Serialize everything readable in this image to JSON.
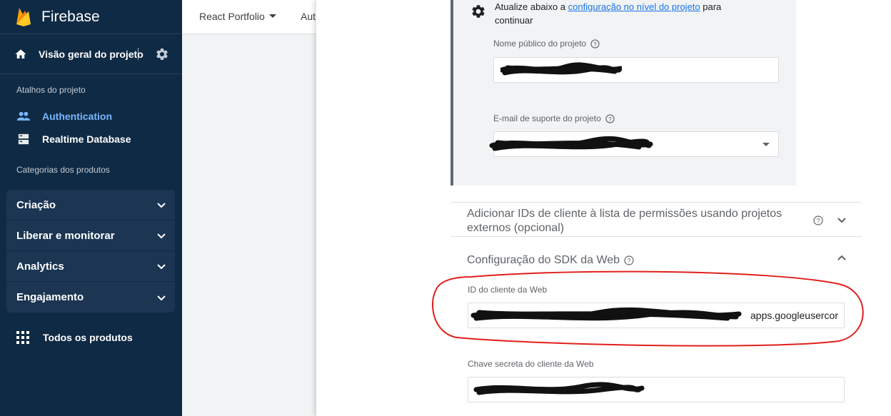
{
  "app": {
    "brand": "Firebase",
    "overview_label": "Visão geral do projeto"
  },
  "sidebar": {
    "shortcuts_title": "Atalhos do projeto",
    "shortcuts": [
      {
        "label": "Authentication",
        "active": true
      },
      {
        "label": "Realtime Database",
        "active": false
      }
    ],
    "categories_title": "Categorias dos produtos",
    "groups": [
      {
        "label": "Criação"
      },
      {
        "label": "Liberar e monitorar"
      },
      {
        "label": "Analytics"
      },
      {
        "label": "Engajamento"
      }
    ],
    "all_products": "Todos os produtos"
  },
  "topbar": {
    "project_name": "React Portfolio",
    "tab_fragment": "Aut"
  },
  "panel": {
    "notice_prefix": "Atualize abaixo a ",
    "notice_link": "configuração no nível do projeto",
    "notice_suffix": " para continuar",
    "public_name_label": "Nome público do projeto",
    "support_email_label": "E-mail de suporte do projeto",
    "allowlist_title": "Adicionar IDs de cliente à lista de permissões usando projetos externos (opcional)",
    "sdk_title": "Configuração do SDK da Web",
    "client_id_label": "ID do cliente da Web",
    "client_id_value_visible": "apps.googleusercor",
    "client_secret_label": "Chave secreta do cliente da Web"
  },
  "colors": {
    "sidebar_bg": "#0f2a44",
    "active_link": "#7ab6ff",
    "link_blue": "#1a73e8",
    "annotation_red": "#e0201b"
  }
}
